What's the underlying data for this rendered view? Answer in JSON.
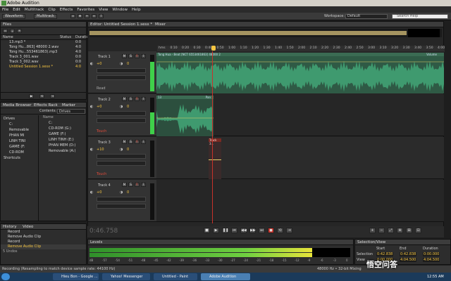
{
  "window": {
    "title": "Adobe Audition"
  },
  "menu": [
    "File",
    "Edit",
    "Multitrack",
    "Clip",
    "Effects",
    "Favorites",
    "View",
    "Window",
    "Help"
  ],
  "toolbar": {
    "waveform_label": "Waveform",
    "multitrack_label": "Multitrack",
    "workspace_label": "Workspace:",
    "workspace_value": "Default",
    "search_placeholder": "Search Help"
  },
  "files_panel": {
    "title": "Files",
    "col_name": "Name",
    "col_status": "Status",
    "col_duration": "Duration",
    "items": [
      {
        "name": "13.mp3 *",
        "dur": "0:0"
      },
      {
        "name": "Tong Hu...863] 48000 2.wav",
        "dur": "4:0"
      },
      {
        "name": "Tong Hu...553461863).mp3",
        "dur": "4:0"
      },
      {
        "name": "Track 3_001.wav",
        "dur": "0:0"
      },
      {
        "name": "Track 3_002.wav",
        "dur": "0:0"
      },
      {
        "name": "Untitled Session 1.sesx *",
        "dur": "4:0"
      }
    ]
  },
  "media_browser": {
    "tabs": [
      "Media Browser",
      "Effects Rack",
      "Marker"
    ],
    "contents_label": "Contents:",
    "contents_value": "Drives",
    "tree": [
      "Drives",
      "C:",
      "Removable",
      "PHAN MI",
      "LINH TINI",
      "GAME (F:",
      "CD-ROM",
      "Shortcuts"
    ],
    "drives_label": "Name",
    "drives": [
      "C:",
      "CD-ROM (G:)",
      "GAME (F:)",
      "LINH TINH (E:)",
      "PHAN MEM (D:)",
      "Removable (A:)"
    ]
  },
  "history": {
    "tabs": [
      "History",
      "Video"
    ],
    "items": [
      "Record",
      "Remove Audio Clip",
      "Record",
      "Remove Audio Clip"
    ],
    "footer": "5 Undos"
  },
  "editor": {
    "tab_title": "Editor: Untitled Session 1.sesx *",
    "mixer_tab": "Mixer",
    "ruler": [
      "hms",
      "0:10",
      "0:20",
      "0:30",
      "0:40",
      "0:50",
      "1:00",
      "1:10",
      "1:20",
      "1:30",
      "1:40",
      "1:50",
      "2:00",
      "2:10",
      "2:20",
      "2:30",
      "2:40",
      "2:50",
      "3:00",
      "3:10",
      "3:20",
      "3:30",
      "3:40",
      "3:50",
      "4:00"
    ],
    "time": "0:46.758",
    "clip1_label": "Tong Hua - Beat [NCT 6553461863] 48000 2",
    "clip2_label": "13",
    "clip2_right": "Pan",
    "clip3_label": "Track 3...",
    "volume_label": "Volume"
  },
  "tracks": [
    {
      "name": "Track 1",
      "vol": "+0",
      "pan": "0",
      "read": "Read",
      "meter": 0.8
    },
    {
      "name": "Track 2",
      "vol": "+0",
      "pan": "0",
      "read": "Touch",
      "meter": 0.6
    },
    {
      "name": "Track 3",
      "vol": "+10",
      "pan": "0",
      "read": "Touch",
      "meter": 0.0
    },
    {
      "name": "Track 4",
      "vol": "+0",
      "pan": "0",
      "read": "",
      "meter": 0.0
    }
  ],
  "levels": {
    "title": "Levels",
    "scale": [
      "dB",
      "-57",
      "-54",
      "-51",
      "-48",
      "-45",
      "-42",
      "-39",
      "-36",
      "-33",
      "-30",
      "-27",
      "-24",
      "-21",
      "-18",
      "-15",
      "-12",
      "-9",
      "-6",
      "-3",
      "0"
    ]
  },
  "selection": {
    "title": "Selection/View",
    "cols": [
      "Start",
      "End",
      "Duration"
    ],
    "rows": [
      {
        "label": "Selection",
        "start": "0:42.838",
        "end": "0:42.838",
        "dur": "0:00.000"
      },
      {
        "label": "View",
        "start": "0:00.000",
        "end": "4:04.500",
        "dur": "4:04.500"
      }
    ]
  },
  "status": {
    "text": "Recording (Resampling to match device sample rate: 44100 Hz)",
    "right": "48000 Hz • 32-bit Mixing"
  },
  "taskbar": {
    "items": [
      "Hieu Bon - Google ...",
      "Yahoo! Messenger",
      "Untitled - Paint",
      "Adobe Audition"
    ],
    "clock": "12:55 AM",
    "watermark": "悟空问答"
  },
  "colors": {
    "wave": "#3f9a6f",
    "accent": "#f5c542",
    "playhead": "#c8322a",
    "meter": "#3fd04a"
  }
}
